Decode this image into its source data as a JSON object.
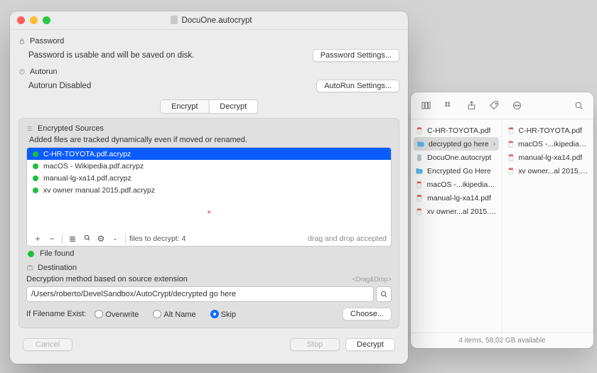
{
  "main": {
    "title": "DocuOne.autocrypt",
    "password": {
      "section": "Password",
      "text": "Password is usable and will be saved on disk.",
      "button": "Password Settings..."
    },
    "autorun": {
      "section": "Autorun",
      "text": "Autorun Disabled",
      "button": "AutoRun Settings..."
    },
    "tabs": {
      "a": "Encrypt",
      "b": "Decrypt"
    },
    "sources": {
      "section": "Encrypted Sources",
      "hint": "Added files are tracked dynamically  even if moved or renamed.",
      "files": [
        "C-HR-TOYOTA.pdf.acrypz",
        "macOS - Wikipedia.pdf.acrypz",
        "manual-lg-xa14.pdf.acrypz",
        "xv owner manual 2015.pdf.acrypz"
      ],
      "footer_count": "files to decrypt: 4",
      "footer_hint": "drag and drop accepted",
      "status": "File found"
    },
    "dest": {
      "section": "Destination",
      "label": "Decryption method based on source extension",
      "dragdrop": "<Drag&Drop>",
      "path": "/Users/roberto/DevelSandbox/AutoCrypt/decrypted go here",
      "exist_label": "If Filename Exist:",
      "o1": "Overwrite",
      "o2": "Alt Name",
      "o3": "Skip",
      "choose": "Choose..."
    },
    "footer": {
      "cancel": "Cancel",
      "stop": "Stop",
      "go": "Decrypt"
    }
  },
  "finder": {
    "col1": [
      {
        "n": "C-HR-TOYOTA.pdf",
        "t": "pdf"
      },
      {
        "n": "decrypted go here",
        "t": "folder",
        "sel": true
      },
      {
        "n": "DocuOne.autocrypt",
        "t": "doc"
      },
      {
        "n": "Encrypted Go Here",
        "t": "folder"
      },
      {
        "n": "macOS -...ikipedia.pdf",
        "t": "pdf"
      },
      {
        "n": "manual-lg-xa14.pdf",
        "t": "pdf"
      },
      {
        "n": "xv owner...al 2015.pdf",
        "t": "pdf"
      }
    ],
    "col2": [
      {
        "n": "C-HR-TOYOTA.pdf",
        "t": "pdf"
      },
      {
        "n": "macOS -...ikipedia.pdf",
        "t": "pdf"
      },
      {
        "n": "manual-lg-xa14.pdf",
        "t": "pdf"
      },
      {
        "n": "xv owner...al 2015.pdf",
        "t": "pdf"
      }
    ],
    "status": "4 items, 58,02 GB available"
  }
}
